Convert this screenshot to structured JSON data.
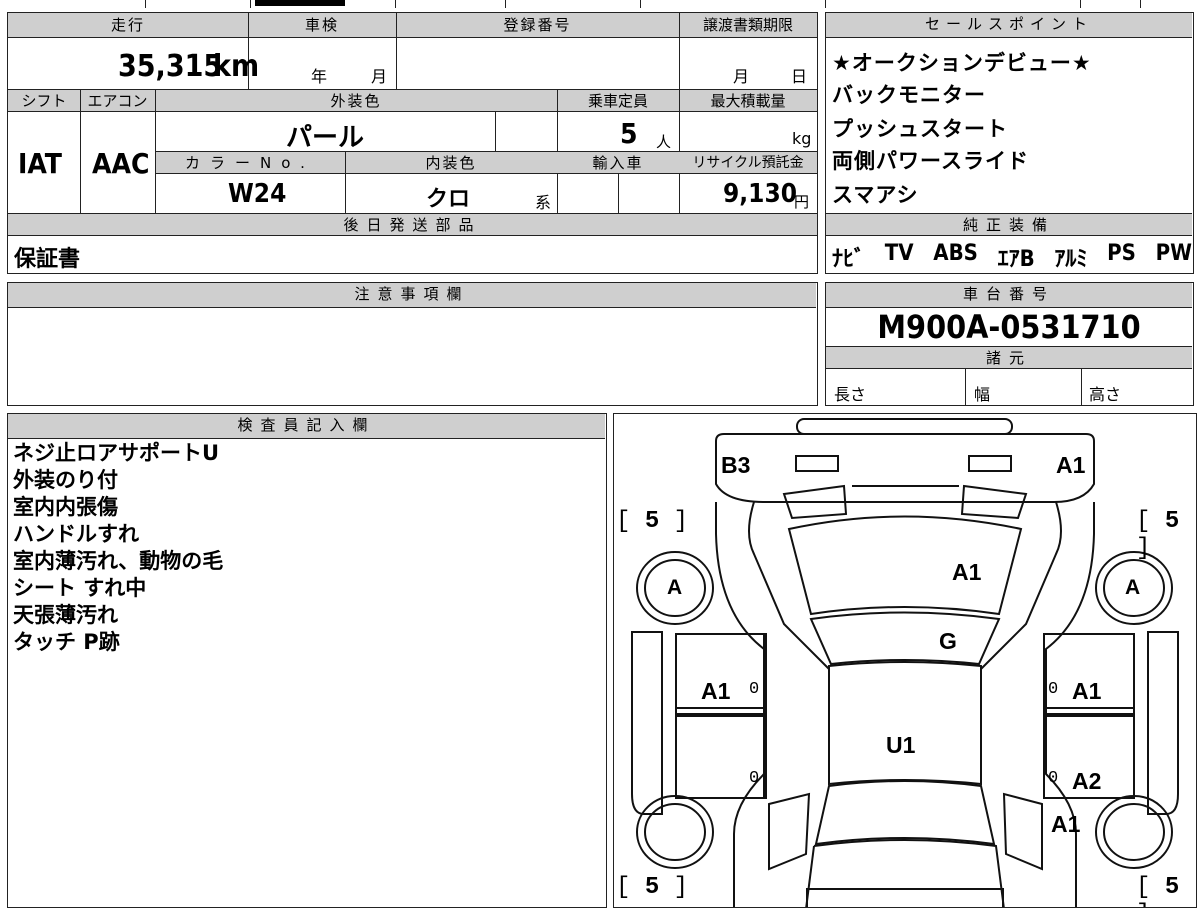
{
  "vehicle": {
    "mileage_label": "走行",
    "mileage": "35,315",
    "mileage_unit": "km",
    "inspection_label": "車検",
    "inspection_year": "年",
    "inspection_month": "月",
    "registration_label": "登録番号",
    "transfer_deadline_label": "譲渡書類期限",
    "transfer_month": "月",
    "transfer_day": "日",
    "shift_label": "シフト",
    "shift": "IAT",
    "ac_label": "エアコン",
    "ac": "AAC",
    "exterior_color_label": "外装色",
    "exterior_color": "パール",
    "capacity_label": "乗車定員",
    "capacity": "5",
    "capacity_unit": "人",
    "max_load_label": "最大積載量",
    "max_load_unit": "kg",
    "color_no_label": "カラーNo.",
    "color_no": "W24",
    "interior_color_label": "内装色",
    "interior_color": "クロ",
    "interior_color_suffix": "系",
    "import_label": "輸入車",
    "recycle_label": "リサイクル預託金",
    "recycle_fee": "9,130",
    "recycle_unit": "円",
    "later_parts_label": "後日発送部品",
    "later_parts": "保証書"
  },
  "sales": {
    "label": "セールスポイント",
    "points": [
      "★オークションデビュー★",
      "バックモニター",
      "プッシュスタート",
      "両側パワースライド",
      "スマアシ"
    ]
  },
  "equipment": {
    "label": "純正装備",
    "items": [
      "ﾅﾋﾞ",
      "TV",
      "ABS",
      "ｴｱB",
      "ｱﾙﾐ",
      "PS",
      "PW"
    ]
  },
  "notes": {
    "label": "注意事項欄"
  },
  "chassis": {
    "label": "車台番号",
    "number": "M900A-0531710",
    "specs_label": "諸元",
    "length_label": "長さ",
    "width_label": "幅",
    "height_label": "高さ"
  },
  "inspector": {
    "label": "検査員記入欄",
    "lines": [
      "ネジ止ロアサポートU",
      "外装のり付",
      "室内内張傷",
      "ハンドルすれ",
      "室内薄汚れ、動物の毛",
      "シート すれ中",
      "天張薄汚れ",
      "タッチ P跡"
    ]
  },
  "diagram": {
    "marks": {
      "front_left": "B3",
      "front_right": "A1",
      "hood": "A1",
      "windshield": "G",
      "roof": "U1",
      "left_front_door": "A1",
      "right_front_door": "A1",
      "right_rear_door": "A2",
      "right_rear_fender": "A1",
      "left_front_tire": "A",
      "right_front_tire": "A"
    },
    "tread": {
      "tl": "5",
      "tr": "5",
      "bl": "5",
      "br": "5"
    },
    "zero": "0"
  }
}
